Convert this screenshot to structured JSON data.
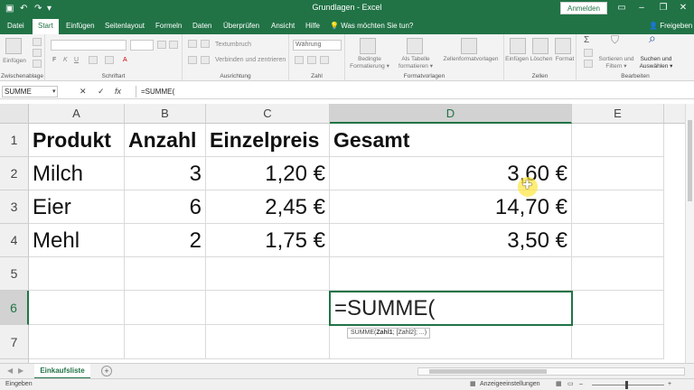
{
  "titlebar": {
    "title": "Grundlagen - Excel",
    "signin_label": "Anmelden"
  },
  "tabs": [
    {
      "label": "Datei"
    },
    {
      "label": "Start",
      "active": true
    },
    {
      "label": "Einfügen"
    },
    {
      "label": "Seitenlayout"
    },
    {
      "label": "Formeln"
    },
    {
      "label": "Daten"
    },
    {
      "label": "Überprüfen"
    },
    {
      "label": "Ansicht"
    },
    {
      "label": "Hilfe"
    }
  ],
  "tell_me": "Was möchten Sie tun?",
  "share_label": "Freigeben",
  "ribbon": {
    "paste_label": "Einfügen",
    "wrap_text": "Textumbruch",
    "merge_center": "Verbinden und zentrieren",
    "number_format": "Währung",
    "conditional_format": [
      "Bedingte",
      "Formatierung ▾"
    ],
    "format_as_table": [
      "Als Tabelle",
      "formatieren ▾"
    ],
    "cell_styles": "Zellenformatvorlagen",
    "insert_cells": "Einfügen",
    "delete_cells": "Löschen",
    "format_cells": "Format",
    "sort_filter": [
      "Sortieren und",
      "Filtern ▾"
    ],
    "find_select": [
      "Suchen und",
      "Auswählen ▾"
    ],
    "groups": [
      "Zwischenablage",
      "Schriftart",
      "Ausrichtung",
      "Zahl",
      "Formatvorlagen",
      "Zellen",
      "Bearbeiten"
    ]
  },
  "formula_bar": {
    "name_box": "SUMME",
    "formula": "=SUMME("
  },
  "grid": {
    "columns": [
      "A",
      "B",
      "C",
      "D",
      "E"
    ],
    "rows": [
      "1",
      "2",
      "3",
      "4",
      "5",
      "6",
      "7"
    ],
    "header_row": [
      "Produkt",
      "Anzahl",
      "Einzelpreis",
      "Gesamt"
    ],
    "data": [
      [
        "Milch",
        "3",
        "1,20 €",
        "3,60 €"
      ],
      [
        "Eier",
        "6",
        "2,45 €",
        "14,70 €"
      ],
      [
        "Mehl",
        "2",
        "1,75 €",
        "3,50 €"
      ]
    ],
    "active_cell_value": "=SUMME(",
    "tooltip": {
      "fn": "SUMME(",
      "arg1": "Zahl1",
      "rest": "; [Zahl2]; ...)"
    }
  },
  "sheet": {
    "tab_label": "Einkaufsliste",
    "add_label": "+"
  },
  "status": {
    "mode": "Eingeben",
    "display_settings": "Anzeigeeinstellungen"
  }
}
